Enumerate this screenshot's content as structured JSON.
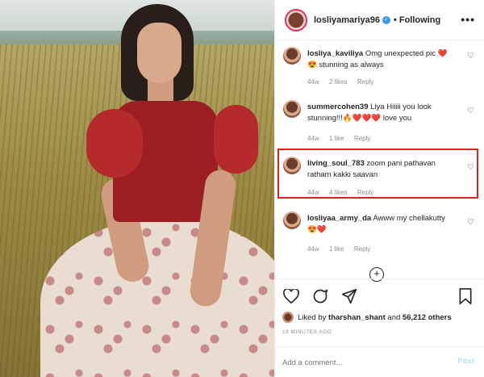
{
  "header": {
    "username": "losliyamariya96",
    "follow_label": "• Following",
    "more_label": "•••"
  },
  "comments": [
    {
      "username": "losliya_kaviliya",
      "text": "Omg unexpected pic ❤️😍 stunning as always",
      "time": "44w",
      "likes": "2 likes",
      "reply": "Reply"
    },
    {
      "username": "summercohen39",
      "text": "Liya Hiiiii you look stunning!!!🔥❤️❤️❤️ love you",
      "time": "44w",
      "likes": "1 like",
      "reply": "Reply"
    },
    {
      "username": "living_soul_783",
      "text": "zoom pani pathavan ratham kakki saavan",
      "time": "44w",
      "likes": "4 likes",
      "reply": "Reply"
    },
    {
      "username": "losliyaa_army_da",
      "text": "Awww my chellakutty 😍❤️",
      "time": "44w",
      "likes": "1 like",
      "reply": "Reply"
    }
  ],
  "likes": {
    "prefix": "Liked by",
    "user": "tharshan_shant",
    "and": "and",
    "count": "56,212 others"
  },
  "date": "18 MINUTES AGO",
  "add_comment": {
    "placeholder": "Add a comment...",
    "post_label": "Post"
  },
  "colors": {
    "highlight": "#e0201f",
    "verified": "#3897f0",
    "post_disabled": "#b2dffc"
  }
}
